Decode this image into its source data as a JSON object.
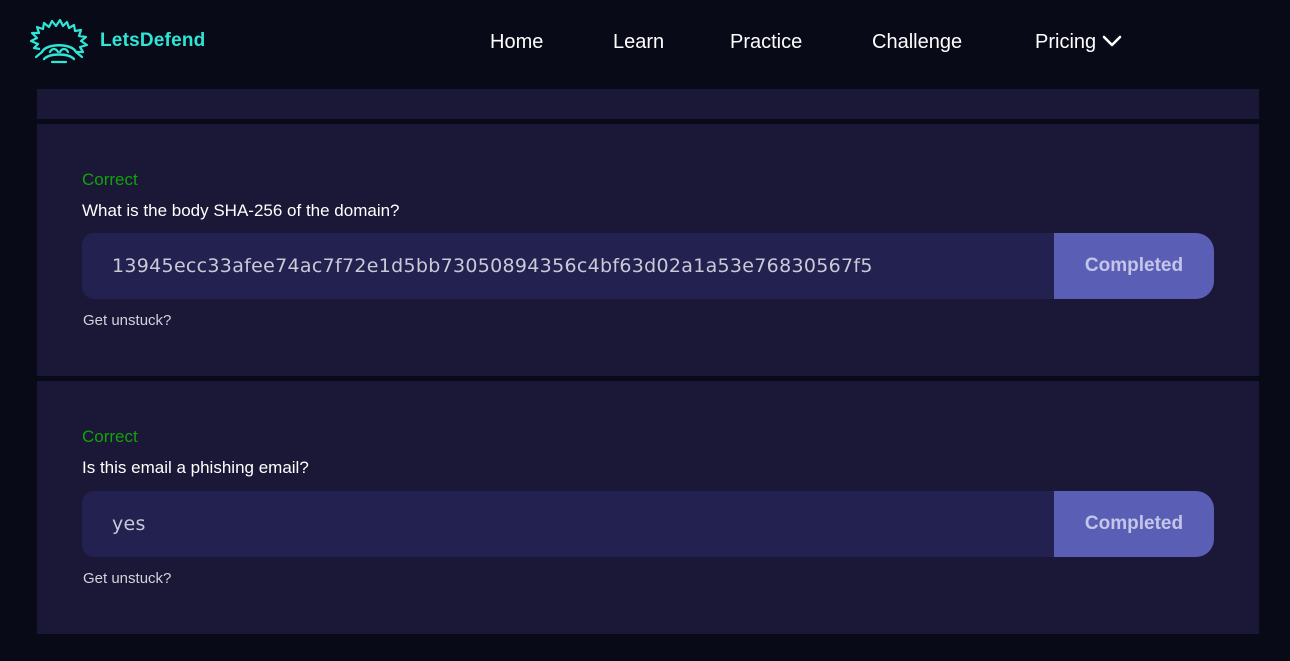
{
  "brand": {
    "name": "LetsDefend",
    "color": "#2ee6d6"
  },
  "nav": {
    "items": [
      {
        "label": "Home"
      },
      {
        "label": "Learn"
      },
      {
        "label": "Practice"
      },
      {
        "label": "Challenge"
      },
      {
        "label": "Pricing",
        "icon": "chevron-down-icon"
      }
    ]
  },
  "questions": [
    {
      "status": "Correct",
      "question": "What is the body SHA-256 of the domain?",
      "answer": "13945ecc33afee74ac7f72e1d5bb73050894356c4bf63d02a1a53e76830567f5",
      "button_label": "Completed",
      "help_link": "Get unstuck?"
    },
    {
      "status": "Correct",
      "question": "Is this email a phishing email?",
      "answer": "yes",
      "button_label": "Completed",
      "help_link": "Get unstuck?"
    }
  ],
  "colors": {
    "background": "#080a18",
    "panel": "#1a1836",
    "input": "#23214f",
    "button": "#5a5fb5",
    "correct": "#13a10e"
  }
}
